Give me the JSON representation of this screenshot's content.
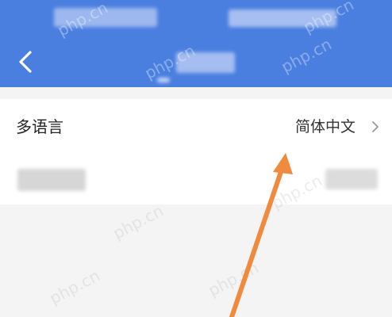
{
  "header": {
    "back_icon": "chevron-left-icon",
    "background": "#4a7fe0"
  },
  "settings": {
    "language_row": {
      "label": "多语言",
      "value": "简体中文",
      "chevron_icon": "chevron-right-icon"
    }
  },
  "watermark": {
    "text": "php.cn"
  },
  "annotation": {
    "arrow_color": "#f08a3e",
    "arrow_icon": "arrow-up-annotation"
  }
}
